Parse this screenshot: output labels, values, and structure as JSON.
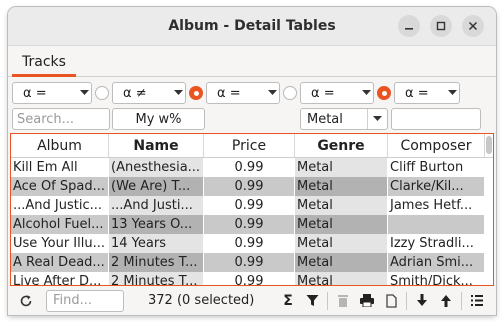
{
  "window": {
    "title": "Album - Detail Tables"
  },
  "tabs": [
    {
      "label": "Tracks"
    }
  ],
  "filters": {
    "operators": [
      "α =",
      "α ≠",
      "α =",
      "α =",
      "α ="
    ],
    "radios": [
      false,
      true,
      false,
      true
    ],
    "search_placeholder": "Search...",
    "name_value": "My w%",
    "genre_value": "Metal",
    "composer_value": ""
  },
  "table": {
    "columns": [
      {
        "label": "Album",
        "bold": false
      },
      {
        "label": "Name",
        "bold": true
      },
      {
        "label": "Price",
        "bold": false
      },
      {
        "label": "Genre",
        "bold": true
      },
      {
        "label": "Composer",
        "bold": false
      }
    ],
    "rows": [
      [
        "Kill Em All",
        "(Anesthesia...",
        "0.99",
        "Metal",
        "Cliff Burton"
      ],
      [
        "Ace Of Spad...",
        "(We Are) T...",
        "0.99",
        "Metal",
        "Clarke/Kil..."
      ],
      [
        "...And Justic...",
        "...And Justi...",
        "0.99",
        "Metal",
        "James Hetf..."
      ],
      [
        "Alcohol Fuel...",
        "13 Years O...",
        "0.99",
        "Metal",
        ""
      ],
      [
        "Use Your Illu...",
        "14 Years",
        "0.99",
        "Metal",
        "Izzy Stradli..."
      ],
      [
        "A Real Dead...",
        "2 Minutes T...",
        "0.99",
        "Metal",
        "Adrian Smi..."
      ],
      [
        "Live After D...",
        "2 Minutes T...",
        "0.99",
        "Metal",
        "Smith/Dick..."
      ]
    ]
  },
  "status": {
    "find_placeholder": "Find...",
    "count": "372 (0 selected)"
  },
  "colors": {
    "accent": "#e95420",
    "row_alt": "#c9c9c9",
    "row_alt_sorted": "#b2b2b2"
  }
}
